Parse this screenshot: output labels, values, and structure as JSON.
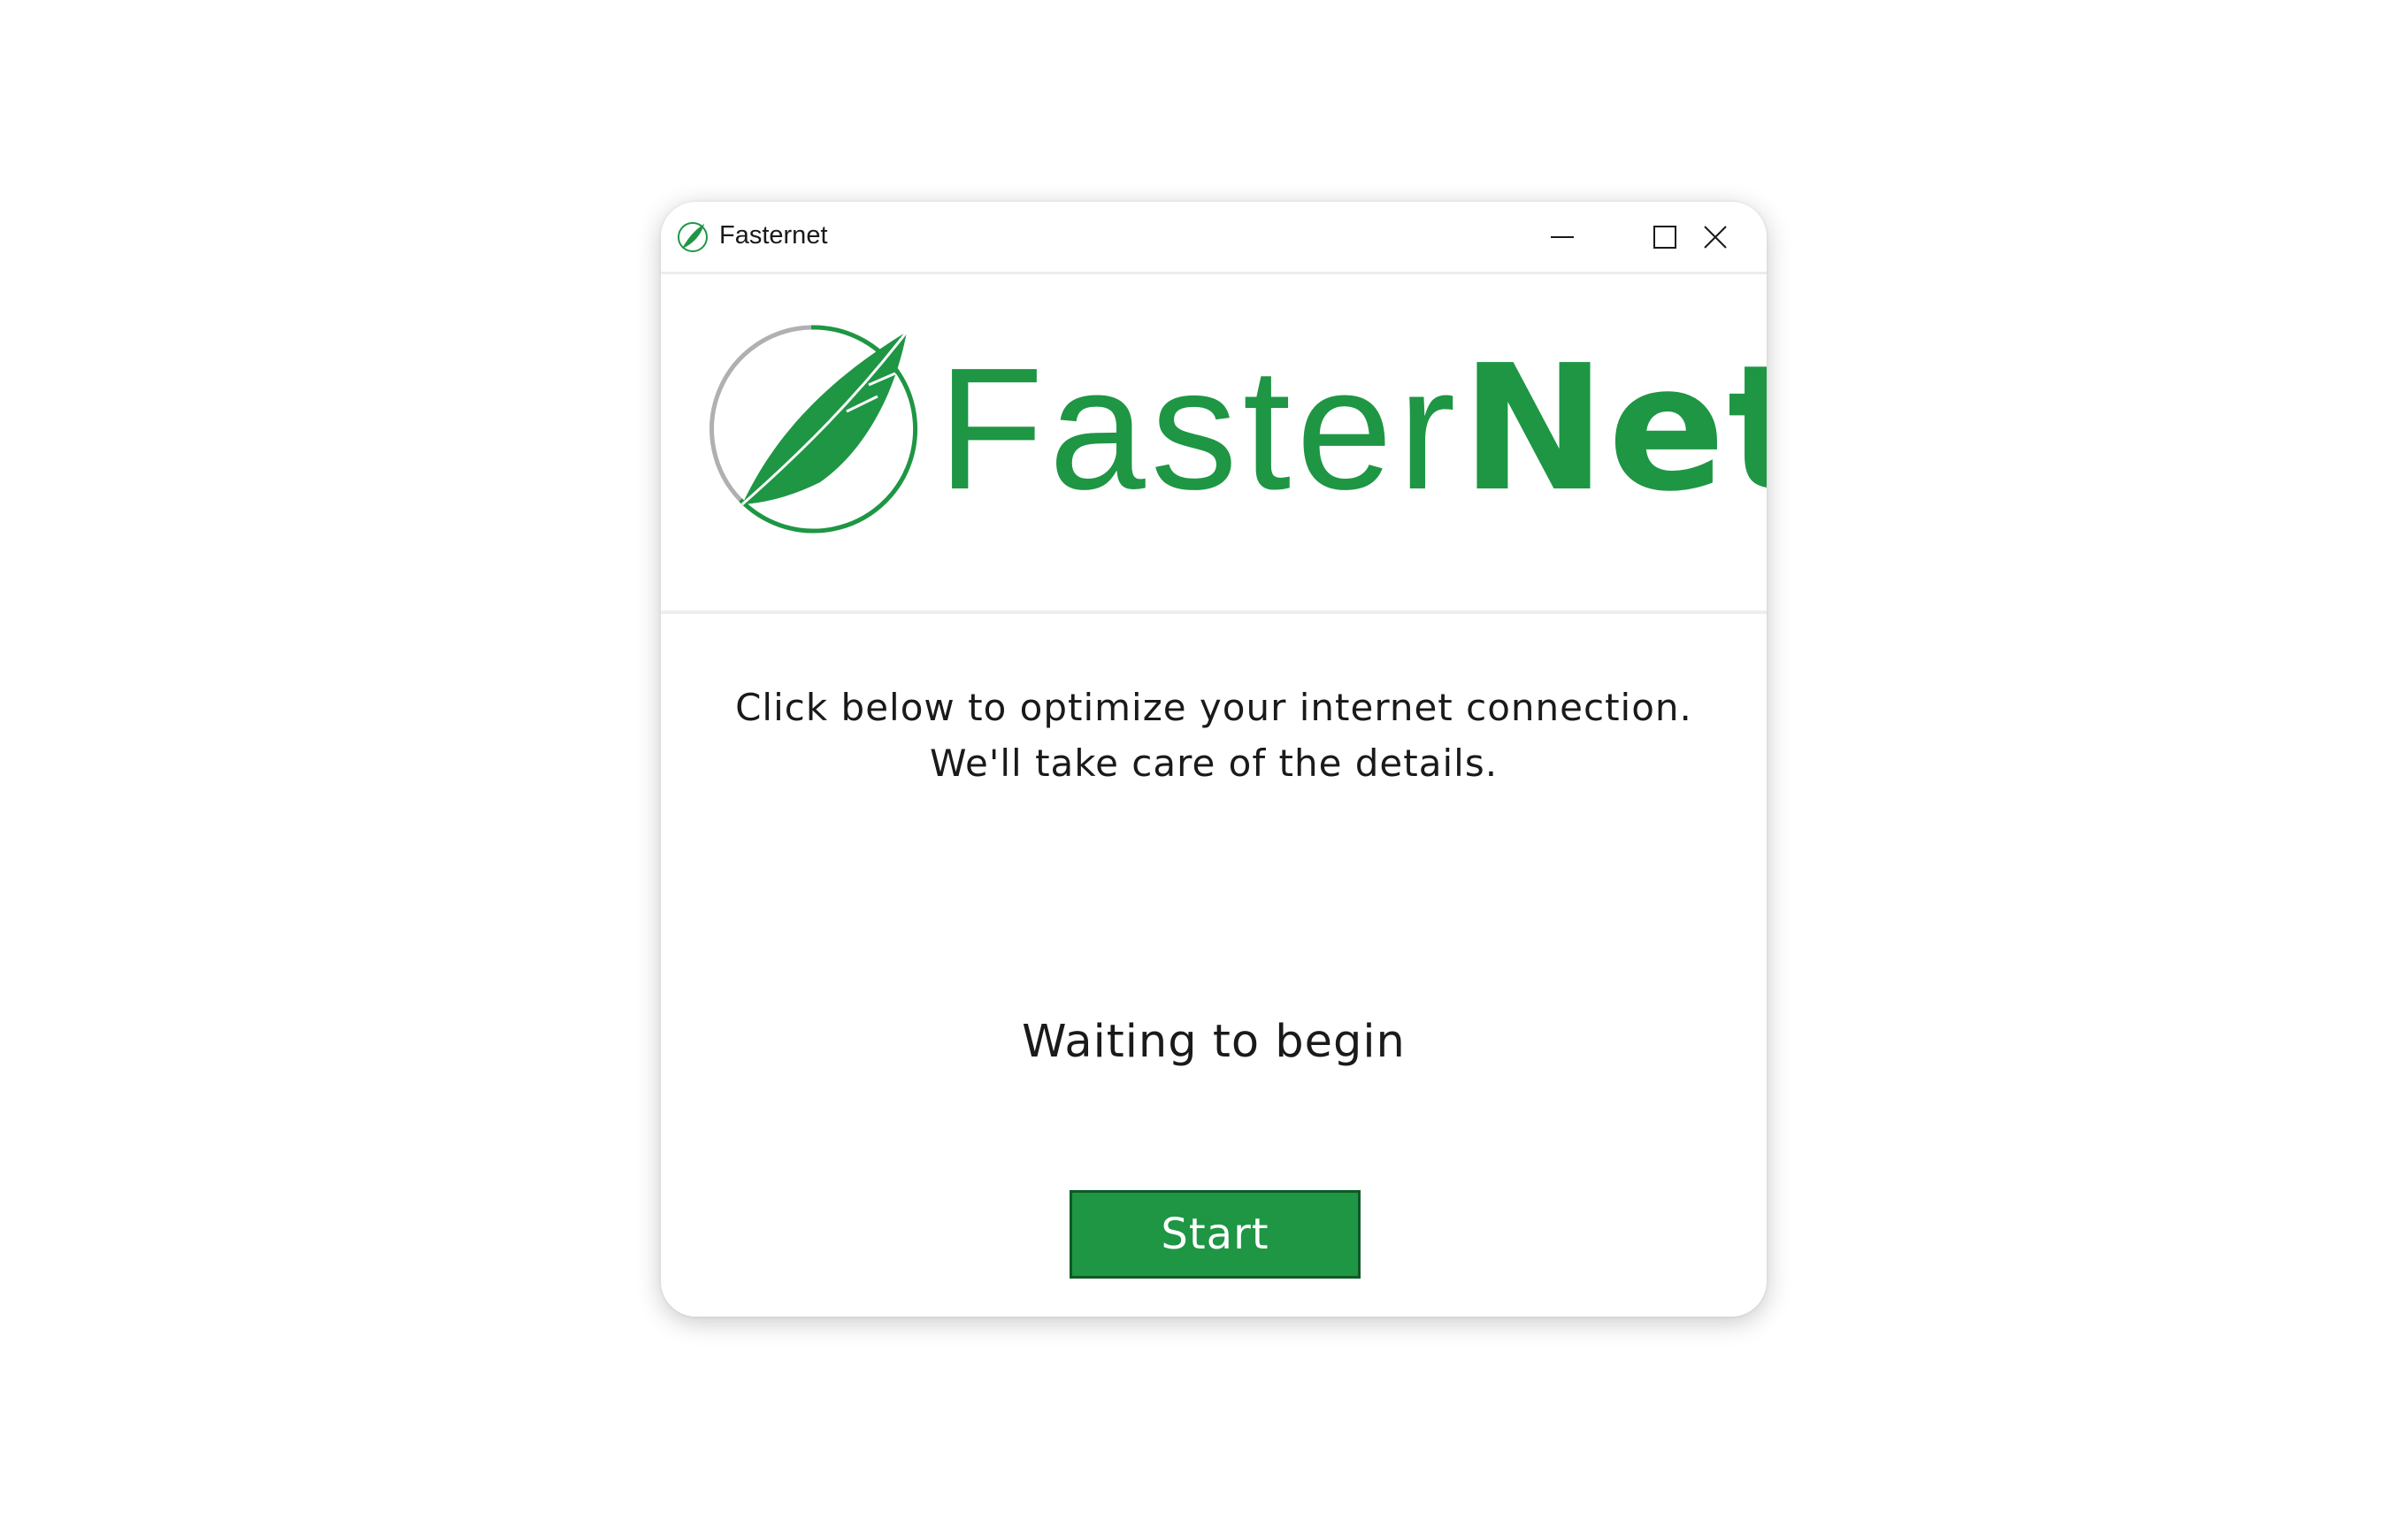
{
  "window": {
    "title": "Fasternet",
    "icon": "feather-icon",
    "controls": {
      "minimize_icon": "minimize-icon",
      "maximize_icon": "maximize-icon",
      "close_icon": "close-icon"
    }
  },
  "logo": {
    "text_light": "Faster",
    "text_bold": "Net",
    "mark_icon": "feather-in-circle-icon",
    "brand_color": "#1e9644"
  },
  "content": {
    "message_line1": "Click below to optimize your internet connection.",
    "message_line2": "We'll take care of the details.",
    "status": "Waiting to begin",
    "start_label": "Start"
  }
}
